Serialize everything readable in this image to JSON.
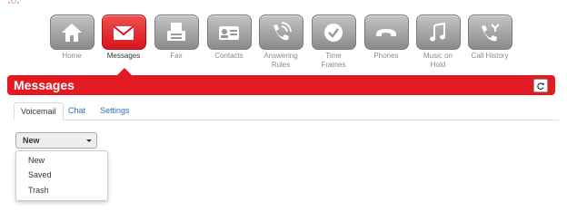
{
  "nav": [
    {
      "id": "home",
      "label": "Home",
      "icon": "home-icon",
      "active": false
    },
    {
      "id": "messages",
      "label": "Messages",
      "icon": "envelope-icon",
      "active": true
    },
    {
      "id": "fax",
      "label": "Fax",
      "icon": "fax-icon",
      "active": false
    },
    {
      "id": "contacts",
      "label": "Contacts",
      "icon": "contact-card-icon",
      "active": false
    },
    {
      "id": "answering-rules",
      "label": "Answering\nRules",
      "icon": "phone-ringing-icon",
      "active": false
    },
    {
      "id": "time-frames",
      "label": "Time\nFrames",
      "icon": "clock-icon",
      "active": false
    },
    {
      "id": "phones",
      "label": "Phones",
      "icon": "handset-icon",
      "active": false
    },
    {
      "id": "music-on-hold",
      "label": "Music on\nHold",
      "icon": "music-note-icon",
      "active": false
    },
    {
      "id": "call-history",
      "label": "Call History",
      "icon": "call-history-icon",
      "active": false
    }
  ],
  "title": "Messages",
  "tabs": [
    {
      "label": "Voicemail",
      "active": true
    },
    {
      "label": "Chat",
      "active": false
    },
    {
      "label": "Settings",
      "active": false
    }
  ],
  "filter": {
    "selected": "New",
    "options": [
      "New",
      "Saved",
      "Trash"
    ]
  },
  "colors": {
    "accent": "#e41a22",
    "tile": "#9a9a9a",
    "link": "#2a6fb5"
  }
}
